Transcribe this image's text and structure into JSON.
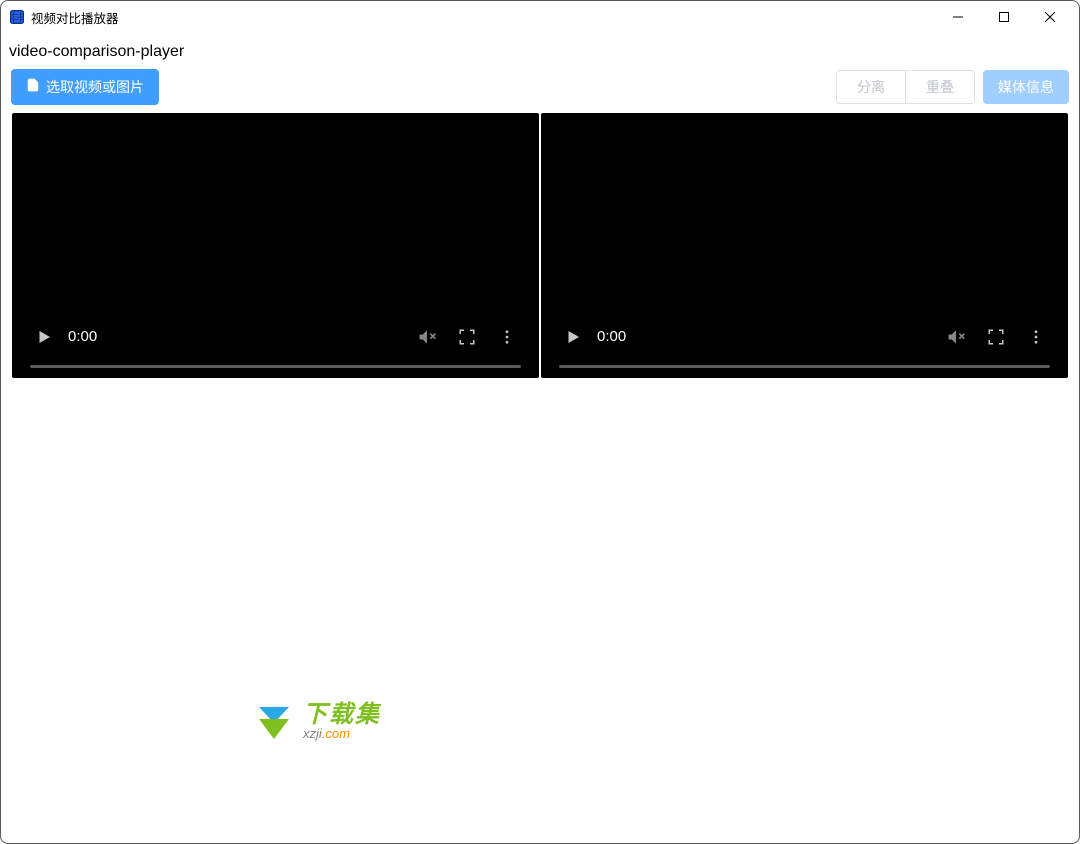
{
  "window": {
    "title": "视频对比播放器"
  },
  "page": {
    "subtitle": "video-comparison-player"
  },
  "toolbar": {
    "select_label": "选取视频或图片",
    "separate_label": "分离",
    "overlap_label": "重叠",
    "media_info_label": "媒体信息"
  },
  "video": {
    "left": {
      "time": "0:00"
    },
    "right": {
      "time": "0:00"
    }
  },
  "watermark": {
    "cn": "下载集",
    "prefix": "xzji",
    "dot": ".",
    "suffix": "com"
  }
}
